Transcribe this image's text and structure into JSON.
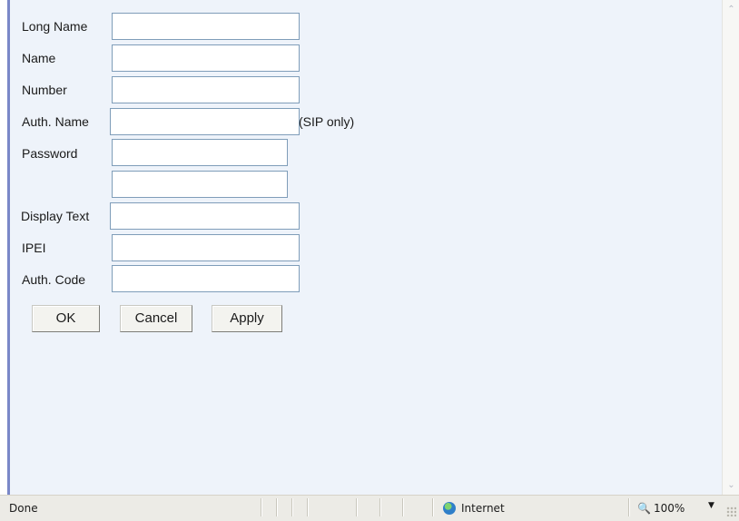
{
  "form": {
    "fields": [
      {
        "label": "Long Name",
        "value": ""
      },
      {
        "label": "Name",
        "value": ""
      },
      {
        "label": "Number",
        "value": ""
      },
      {
        "label": "Auth. Name",
        "value": "",
        "note": "(SIP only)"
      },
      {
        "label": "Password",
        "value": ""
      },
      {
        "label": "",
        "value": ""
      },
      {
        "label": "Display Text",
        "value": ""
      },
      {
        "label": "IPEI",
        "value": ""
      },
      {
        "label": "Auth. Code",
        "value": ""
      }
    ],
    "buttons": {
      "ok": "OK",
      "cancel": "Cancel",
      "apply": "Apply"
    }
  },
  "statusbar": {
    "status": "Done",
    "zone": "Internet",
    "zoom": "100%",
    "icons": {
      "zone": "globe-icon",
      "zoom": "zoom-icon"
    }
  },
  "colors": {
    "content_bg": "#eef3fa",
    "field_border": "#7f9db9",
    "frame_accent": "#7a88c8"
  }
}
